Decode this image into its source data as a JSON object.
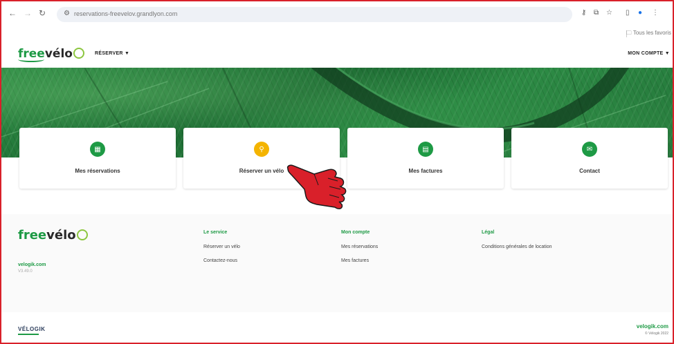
{
  "browser": {
    "url": "reservations-freevelov.grandlyon.com",
    "bookmarks_label": "Tous les favoris"
  },
  "site": {
    "logo_prefix": "free",
    "logo_suffix": "vélo",
    "logo_accent": "v",
    "menu_reserver": "RÉSERVER ▼",
    "menu_compte": "MON COMPTE ▼"
  },
  "cards": [
    {
      "label": "Mes réservations",
      "icon": "calendar-icon",
      "color": "#1e9a45"
    },
    {
      "label": "Réserver un vélo",
      "icon": "bike-icon",
      "color": "#f4b400"
    },
    {
      "label": "Mes factures",
      "icon": "document-icon",
      "color": "#1e9a45"
    },
    {
      "label": "Contact",
      "icon": "mail-icon",
      "color": "#1e9a45"
    }
  ],
  "footer": {
    "velogik_link": "velogik.com",
    "version": "V3.49.0",
    "service": {
      "title": "Le service",
      "links": [
        "Réserver un vélo",
        "Contactez-nous"
      ]
    },
    "account": {
      "title": "Mon compte",
      "links": [
        "Mes réservations",
        "Mes factures"
      ]
    },
    "legal": {
      "title": "Légal",
      "links": [
        "Conditions générales de location"
      ]
    },
    "bottom_logo": "VÉLOGIK",
    "bottom_brand": "velogik.com",
    "copyright": "© Vélogik 2022"
  },
  "colors": {
    "brand_green": "#1e9a45",
    "accent_yellow": "#f4b400",
    "annotation_red": "#d9202a"
  }
}
